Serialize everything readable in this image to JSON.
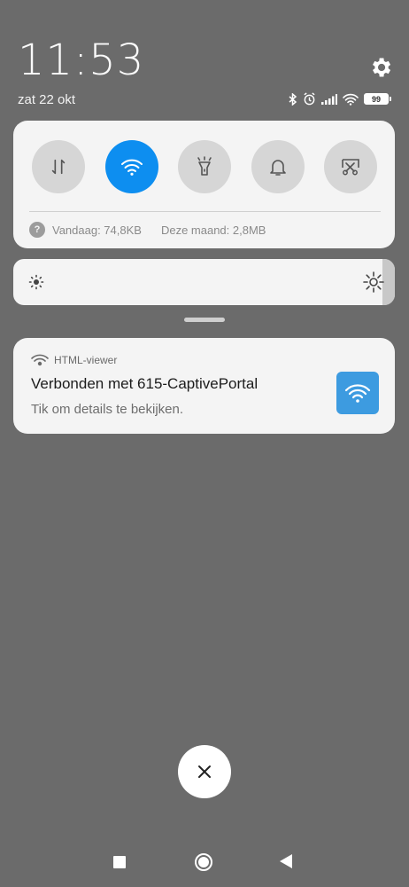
{
  "header": {
    "time": "11:53",
    "date": "zat 22 okt",
    "battery": "99",
    "status_icons": [
      "bluetooth-icon",
      "alarm-icon",
      "signal-icon",
      "wifi-icon",
      "battery-icon"
    ]
  },
  "quick_settings": {
    "toggles": [
      {
        "name": "mobile-data",
        "icon": "data-arrows-icon",
        "on": false
      },
      {
        "name": "wifi",
        "icon": "wifi-icon",
        "on": true
      },
      {
        "name": "flashlight",
        "icon": "flashlight-icon",
        "on": false
      },
      {
        "name": "sound",
        "icon": "bell-icon",
        "on": false
      },
      {
        "name": "screenshot",
        "icon": "scissors-screenshot-icon",
        "on": false
      }
    ],
    "usage": {
      "today": "Vandaag: 74,8KB",
      "month": "Deze maand: 2,8MB",
      "help_mark": "?"
    }
  },
  "brightness": {
    "level": 0.97
  },
  "notification": {
    "app_name": "HTML-viewer",
    "title": "Verbonden met 615-CaptivePortal",
    "text": "Tik om details te bekijken."
  },
  "colors": {
    "accent": "#0d8ef0",
    "notif_icon_bg": "#3d9be0",
    "background": "#6b6b6b"
  }
}
